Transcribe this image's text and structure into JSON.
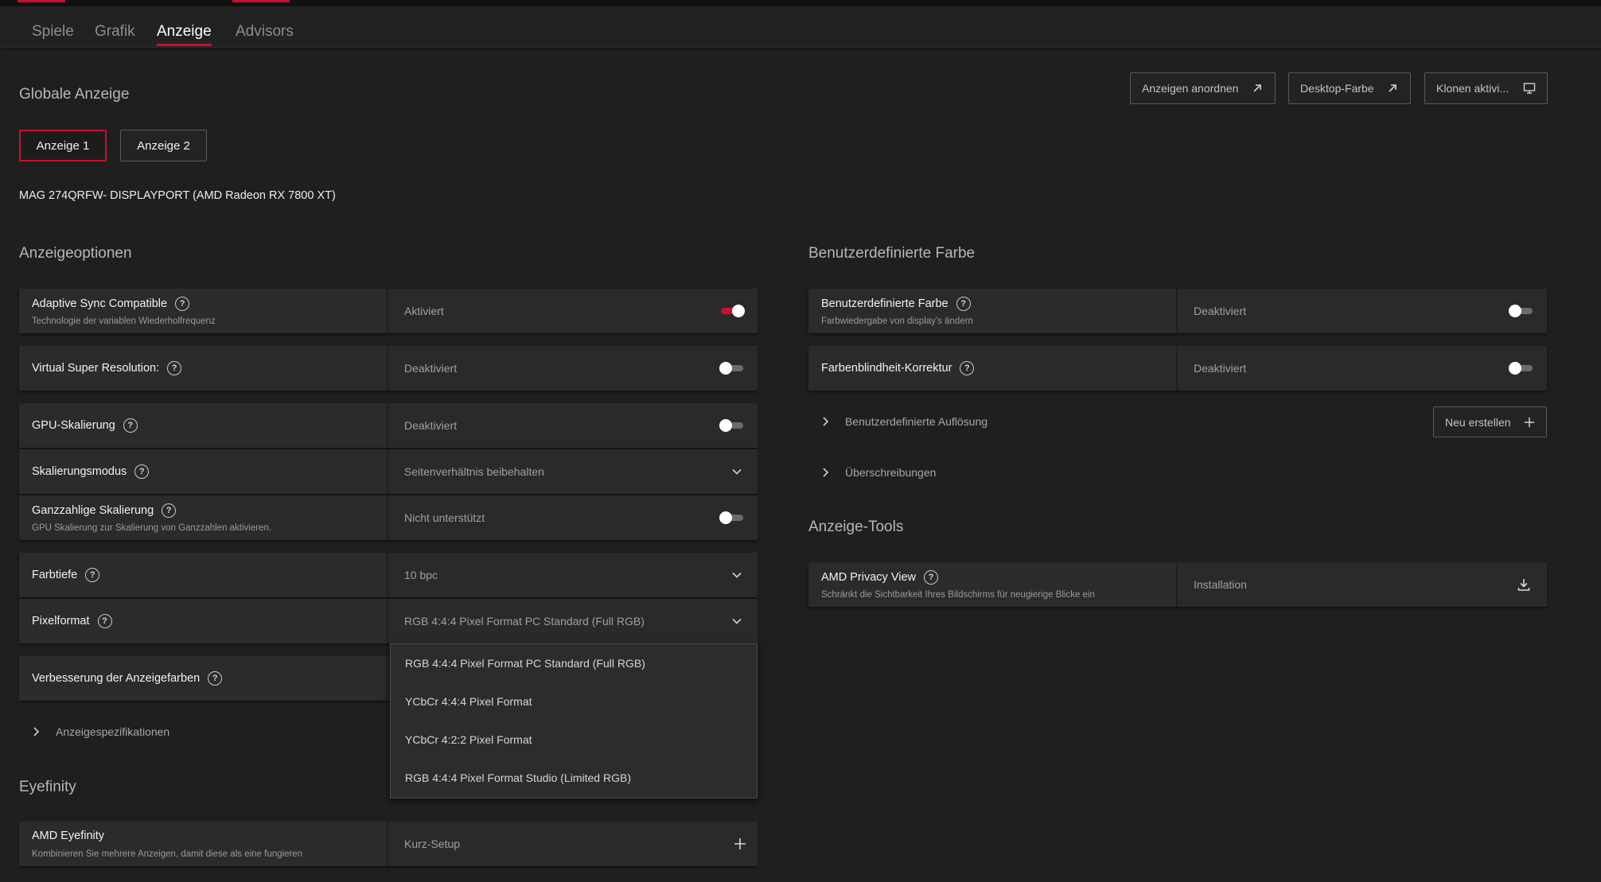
{
  "tabs": [
    {
      "label": "Spiele",
      "active": false
    },
    {
      "label": "Grafik",
      "active": false
    },
    {
      "label": "Anzeige",
      "active": true
    },
    {
      "label": "Advisors",
      "active": false
    }
  ],
  "accent_color": "#c8102e",
  "header": {
    "title": "Globale Anzeige",
    "buttons": [
      {
        "label": "Anzeigen anordnen",
        "icon": "external-arrow-icon"
      },
      {
        "label": "Desktop-Farbe",
        "icon": "external-arrow-icon"
      },
      {
        "label": "Klonen aktivi...",
        "icon": "monitor-icon"
      }
    ]
  },
  "displays": [
    {
      "label": "Anzeige 1",
      "selected": true
    },
    {
      "label": "Anzeige 2",
      "selected": false
    }
  ],
  "monitor": "MAG 274QRFW- DISPLAYPORT (AMD Radeon RX 7800 XT)",
  "left": {
    "title": "Anzeigeoptionen",
    "rows": [
      {
        "title": "Adaptive Sync Compatible",
        "subtitle": "Technologie der variablen Wiederholfrequenz",
        "value": "Aktiviert",
        "control": "toggle",
        "on": true
      },
      {
        "title": "Virtual Super Resolution:",
        "value": "Deaktiviert",
        "control": "toggle",
        "on": false
      },
      {
        "title": "GPU-Skalierung",
        "value": "Deaktiviert",
        "control": "toggle",
        "on": false
      },
      {
        "title": "Skalierungsmodus",
        "value": "Seitenverhältnis beibehalten",
        "control": "dropdown"
      },
      {
        "title": "Ganzzahlige Skalierung",
        "subtitle": "GPU Skalierung zur Skalierung von Ganzzahlen aktivieren.",
        "value": "Nicht unterstützt",
        "control": "toggle",
        "on": false
      },
      {
        "title": "Farbtiefe",
        "value": "10 bpc",
        "control": "dropdown"
      },
      {
        "title": "Pixelformat",
        "value": "RGB 4:4:4 Pixel Format PC Standard (Full RGB)",
        "control": "dropdown",
        "open": true
      },
      {
        "title": "Verbesserung der Anzeigefarben",
        "control": "none"
      }
    ],
    "expander": "Anzeigespezifikationen"
  },
  "pixelformat_options": [
    "RGB 4:4:4 Pixel Format PC Standard (Full RGB)",
    "YCbCr 4:4:4 Pixel Format",
    "YCbCr 4:2:2 Pixel Format",
    "RGB 4:4:4 Pixel Format Studio (Limited RGB)"
  ],
  "eyefinity": {
    "title": "Eyefinity",
    "row": {
      "title": "AMD Eyefinity",
      "subtitle": "Kombinieren Sie mehrere Anzeigen, damit diese als eine fungieren",
      "value": "Kurz-Setup"
    }
  },
  "right": {
    "title": "Benutzerdefinierte Farbe",
    "rows": [
      {
        "title": "Benutzerdefinierte Farbe",
        "subtitle": "Farbwiedergabe von display’s ändern",
        "value": "Deaktiviert",
        "on": false
      },
      {
        "title": "Farbenblindheit-Korrektur",
        "value": "Deaktiviert",
        "on": false
      }
    ],
    "expanders": [
      "Benutzerdefinierte Auflösung",
      "Überschreibungen"
    ],
    "new_button": "Neu erstellen",
    "tools_title": "Anzeige-Tools",
    "tools_row": {
      "title": "AMD Privacy View",
      "subtitle": "Schränkt die Sichtbarkeit Ihres Bildschirms für neugierige Blicke ein",
      "value": "Installation"
    }
  }
}
